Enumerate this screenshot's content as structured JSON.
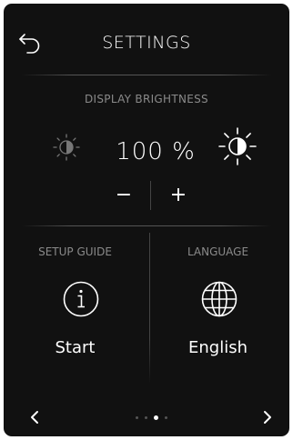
{
  "header": {
    "title": "SETTINGS",
    "back_icon": "back-arrow-icon"
  },
  "brightness": {
    "label": "DISPLAY BRIGHTNESS",
    "value": "100 %",
    "decrease_label": "−",
    "increase_label": "+",
    "low_icon": "brightness-low-icon",
    "high_icon": "brightness-high-icon"
  },
  "setup_guide": {
    "label": "SETUP GUIDE",
    "value": "Start",
    "icon": "info-icon"
  },
  "language": {
    "label": "LANGUAGE",
    "value": "English",
    "icon": "globe-icon"
  },
  "pager": {
    "page_count": 4,
    "active_page": 3
  },
  "colors": {
    "background": "#111111",
    "text": "#ffffff",
    "muted_text": "#8a8a8a",
    "divider": "#444444"
  }
}
